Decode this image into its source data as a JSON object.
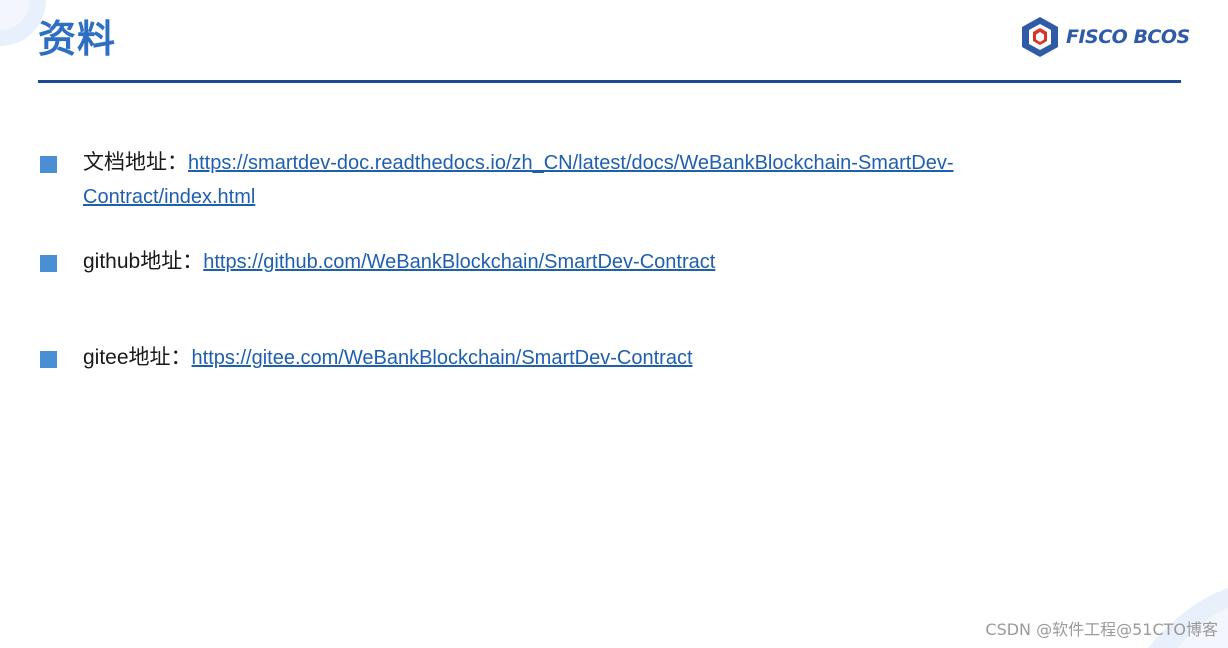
{
  "slide": {
    "title": "资料",
    "logo_text": "FISCO BCOS",
    "colors": {
      "title": "#2e6fc4",
      "rule": "#1e4a94",
      "bullet": "#4a8fd4",
      "link": "#1f5fb0"
    }
  },
  "items": [
    {
      "label": "文档地址：",
      "link": "https://smartdev-doc.readthedocs.io/zh_CN/latest/docs/WeBankBlockchain-SmartDev-Contract/index.html"
    },
    {
      "label": "github地址：",
      "link": "https://github.com/WeBankBlockchain/SmartDev-Contract"
    },
    {
      "label": "gitee地址：",
      "link": "https://gitee.com/WeBankBlockchain/SmartDev-Contract"
    }
  ],
  "watermark": "CSDN @软件工程@51CTO博客"
}
